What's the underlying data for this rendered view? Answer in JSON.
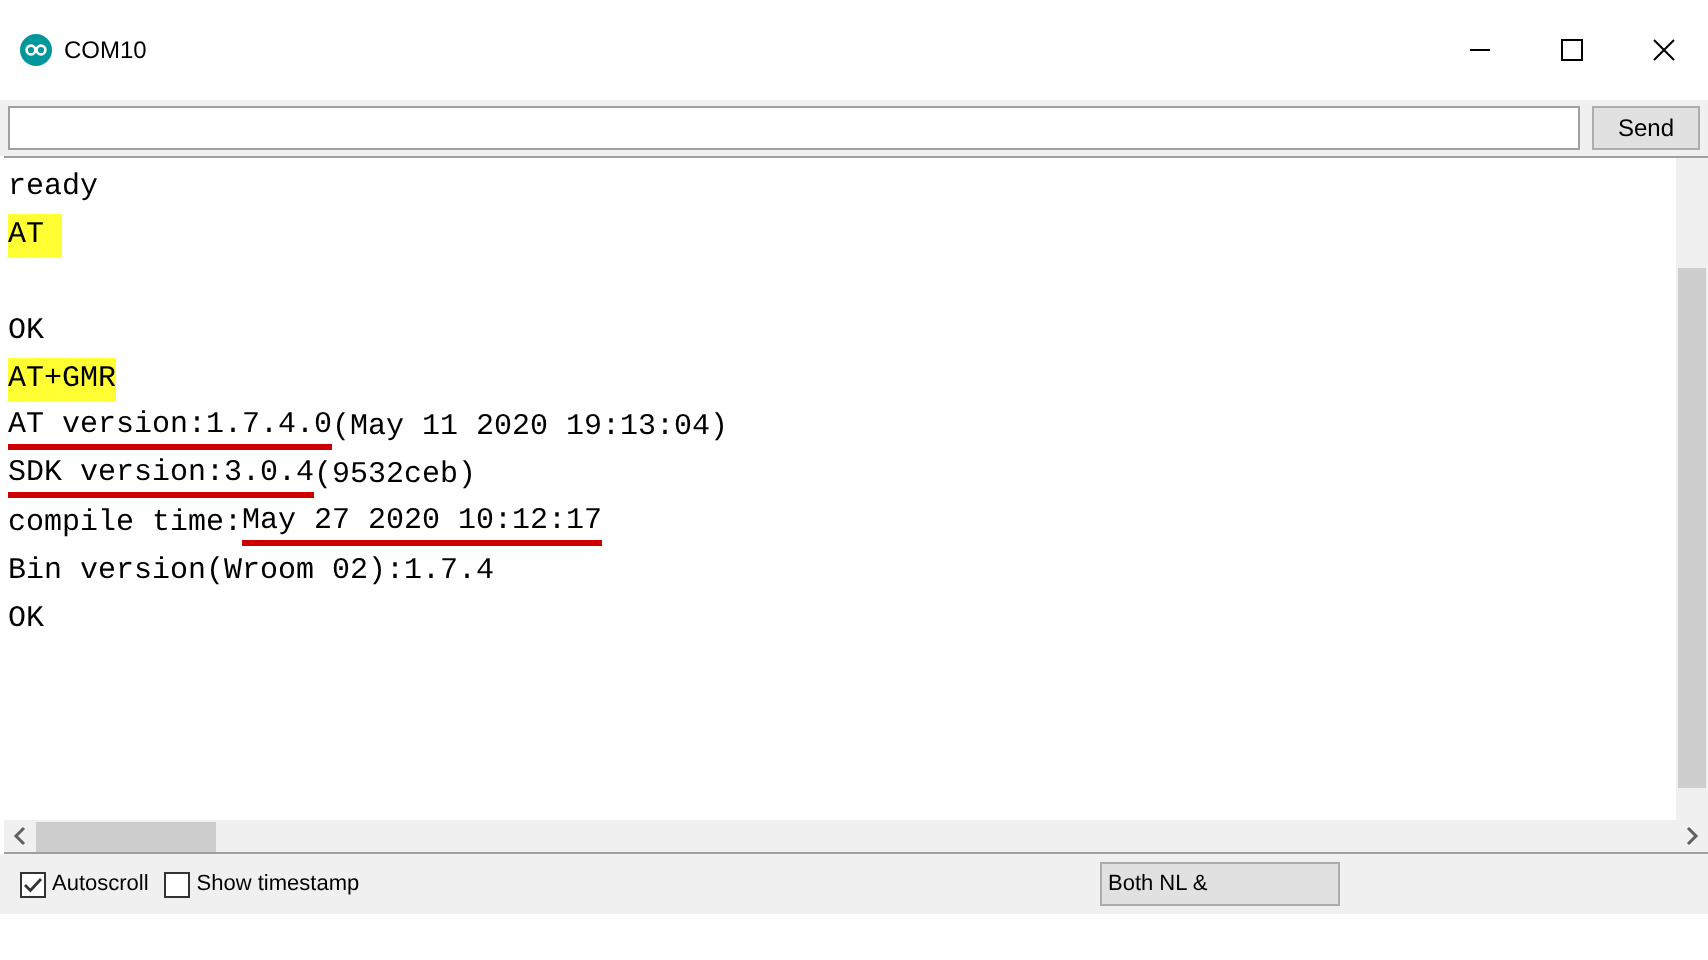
{
  "window": {
    "title": "COM10"
  },
  "input": {
    "button": "Send"
  },
  "output": [
    {
      "kind": "text",
      "segments": [
        {
          "text": "ready",
          "kind": "plain"
        }
      ]
    },
    {
      "kind": "text",
      "segments": [
        {
          "text": "AT ",
          "kind": "highlight"
        }
      ]
    },
    {
      "kind": "blank"
    },
    {
      "kind": "text",
      "segments": [
        {
          "text": "OK",
          "kind": "plain"
        }
      ]
    },
    {
      "kind": "text",
      "segments": [
        {
          "text": "AT+GMR",
          "kind": "highlight"
        }
      ]
    },
    {
      "kind": "text",
      "segments": [
        {
          "text": "AT version:1.7.4.0",
          "kind": "underline"
        },
        {
          "text": "(May 11 2020 19:13:04)",
          "kind": "plain"
        }
      ]
    },
    {
      "kind": "text",
      "segments": [
        {
          "text": "SDK version:3.0.4",
          "kind": "underline"
        },
        {
          "text": "(9532ceb)",
          "kind": "plain"
        }
      ]
    },
    {
      "kind": "text",
      "segments": [
        {
          "text": "compile time:",
          "kind": "plain"
        },
        {
          "text": "May 27 2020 10:12:17",
          "kind": "underline"
        }
      ]
    },
    {
      "kind": "text",
      "segments": [
        {
          "text": "Bin version(Wroom 02):1.7.4",
          "kind": "plain"
        }
      ]
    },
    {
      "kind": "text",
      "segments": [
        {
          "text": "OK",
          "kind": "plain"
        }
      ]
    }
  ],
  "options": [
    {
      "label": "Autoscroll",
      "checked": true
    },
    {
      "label": "Show timestamp",
      "checked": false
    }
  ],
  "line_ending": "Both NL &"
}
